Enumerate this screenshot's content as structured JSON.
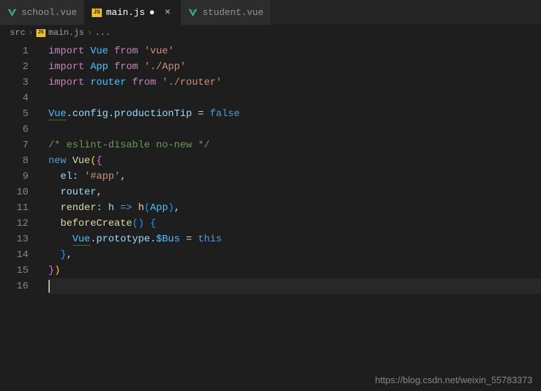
{
  "tabs": [
    {
      "label": "school.vue",
      "icon": "vue"
    },
    {
      "label": "main.js",
      "icon": "js",
      "active": true,
      "dirty": true
    },
    {
      "label": "student.vue",
      "icon": "vue"
    }
  ],
  "breadcrumb": {
    "root": "src",
    "file": "main.js",
    "extra": "..."
  },
  "lines": [
    1,
    2,
    3,
    4,
    5,
    6,
    7,
    8,
    9,
    10,
    11,
    12,
    13,
    14,
    15,
    16
  ],
  "code": {
    "l1": {
      "kw1": "import",
      "id": "Vue",
      "kw2": "from",
      "str": "'vue'"
    },
    "l2": {
      "kw1": "import",
      "id": "App",
      "kw2": "from",
      "str": "'./App'"
    },
    "l3": {
      "kw1": "import",
      "id": "router",
      "kw2": "from",
      "str": "'./router'"
    },
    "l5": {
      "obj": "Vue",
      "p1": ".config.productionTip",
      "eq": " = ",
      "val": "false"
    },
    "l7": {
      "comment": "/* eslint-disable no-new */"
    },
    "l8": {
      "kw": "new",
      "cls": "Vue"
    },
    "l9": {
      "key": "el",
      "colon": ": ",
      "val": "'#app'",
      "comma": ","
    },
    "l10": {
      "id": "router",
      "comma": ","
    },
    "l11": {
      "key": "render",
      "colon": ": ",
      "arg": "h",
      "arrow": " => ",
      "fn": "h",
      "inner": "App",
      "comma": ","
    },
    "l12": {
      "fn": "beforeCreate"
    },
    "l13": {
      "obj": "Vue",
      "mid": ".prototype.",
      "bus": "$Bus",
      "eq": " = ",
      "this": "this"
    },
    "l14": {
      "brace": "}",
      "comma": ","
    }
  },
  "watermark": "https://blog.csdn.net/weixin_55783373"
}
